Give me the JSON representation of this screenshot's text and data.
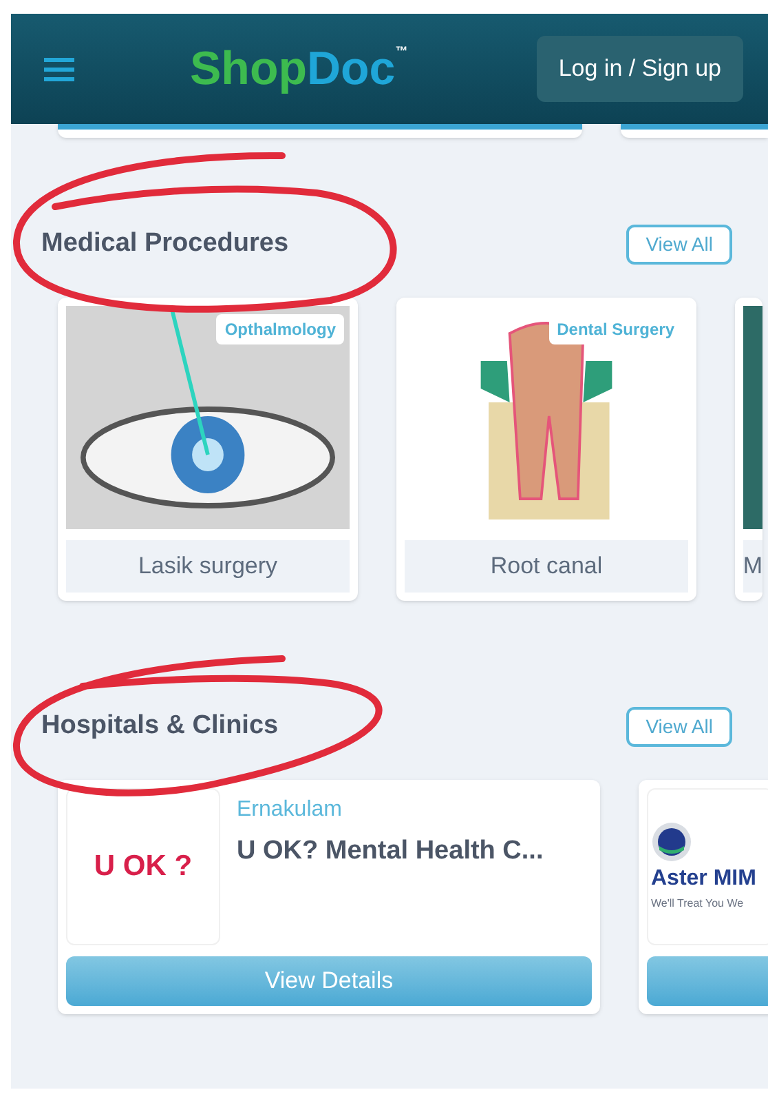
{
  "header": {
    "logo": {
      "first": "Shop",
      "second": "Doc",
      "mark": "™"
    },
    "login_button": "Log in / Sign up"
  },
  "sections": [
    {
      "kind": "procedures",
      "title": "Medical Procedures",
      "view_all": "View All",
      "items": [
        {
          "label": "Lasik surgery",
          "tag": "Opthalmology",
          "kind": "eye"
        },
        {
          "label": "Root canal",
          "tag": "Dental Surgery",
          "kind": "tooth"
        },
        {
          "label": "M",
          "kind": "photo"
        }
      ]
    },
    {
      "kind": "hospitals",
      "title": "Hospitals & Clinics",
      "view_all": "View All",
      "items": [
        {
          "location": "Ernakulam",
          "name": "U OK? Mental Health C...",
          "logo": "U OK ?",
          "button": "View Details"
        },
        {
          "logo": "Aster MIM",
          "logo_tagline": "We'll Treat You We"
        }
      ]
    }
  ]
}
